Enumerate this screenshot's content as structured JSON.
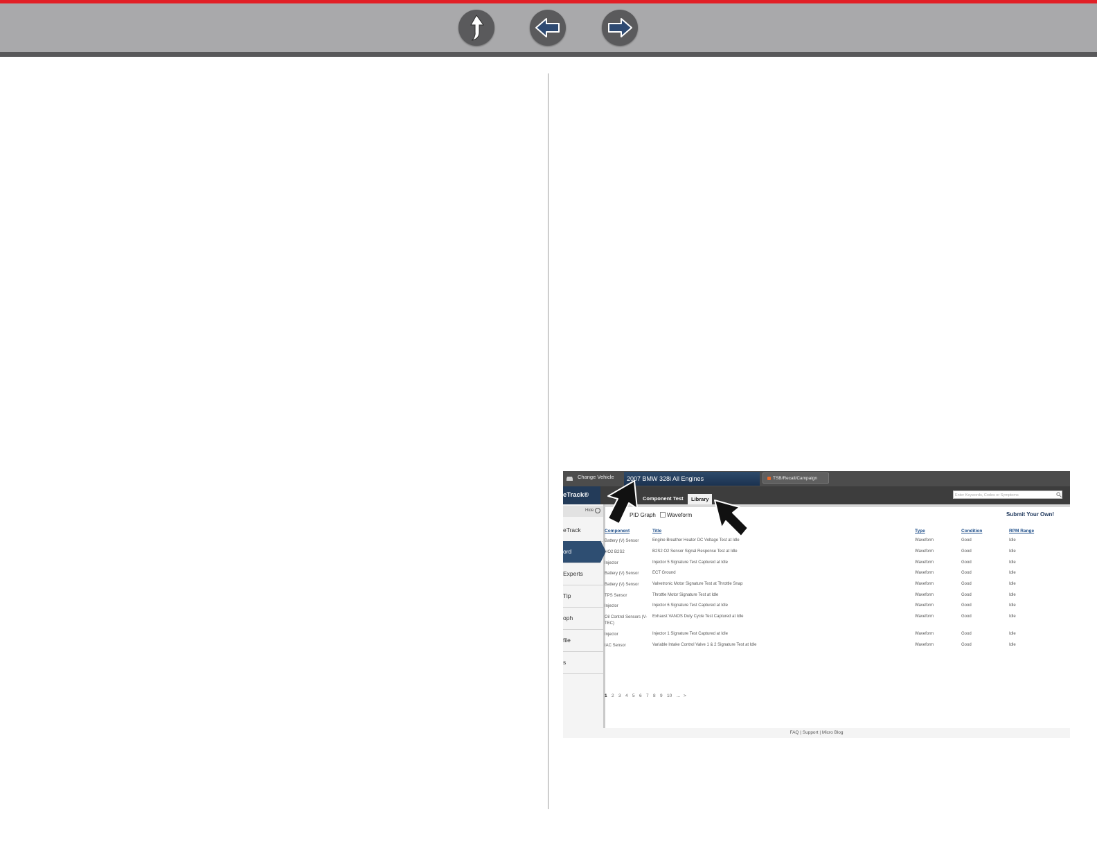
{
  "nav": {
    "up_icon": "up-arrow-icon",
    "back_icon": "left-arrow-icon",
    "forward_icon": "right-arrow-icon",
    "colors": {
      "accent": "#e21f26",
      "bar": "#a9a9ab",
      "button": "#5a5a5c"
    }
  },
  "screenshot": {
    "top_bar": {
      "change_vehicle": "Change Vehicle",
      "vehicle": "2007  BMW  328i  All Engines",
      "tsb": "TSB/Recall/Campaign"
    },
    "brand": "eTrack®",
    "tabs": [
      "Component Test",
      "Library"
    ],
    "search_placeholder": "Enter Keywords, Codes or Symptoms",
    "hide_label": "Hide",
    "sidebar_items": [
      "eTrack",
      "ord",
      "Experts",
      "Tip",
      "oph",
      "file",
      "s"
    ],
    "filters": {
      "pid_graph": "PID Graph",
      "waveform": "Waveform"
    },
    "submit_label": "Submit Your Own!",
    "table": {
      "headers": [
        "Component",
        "Title",
        "Type",
        "Condition",
        "RPM Range"
      ],
      "rows": [
        [
          "Battery (V) Sensor",
          "Engine Breather Heater DC Voltage Test at Idle",
          "Waveform",
          "Good",
          "Idle"
        ],
        [
          "HO2 B2S2",
          "B2S2 O2 Sensor Signal Response Test at Idle",
          "Waveform",
          "Good",
          "Idle"
        ],
        [
          "Injector",
          "Injector 5 Signature Test Captured at Idle",
          "Waveform",
          "Good",
          "Idle"
        ],
        [
          "Battery (V) Sensor",
          "ECT Ground",
          "Waveform",
          "Good",
          "Idle"
        ],
        [
          "Battery (V) Sensor",
          "Valvetronic Motor Signature Test at Throttle Snap",
          "Waveform",
          "Good",
          "Idle"
        ],
        [
          "TPS Sensor",
          "Throttle Motor Signature Test at Idle",
          "Waveform",
          "Good",
          "Idle"
        ],
        [
          "Injector",
          "Injector 6 Signature Test Captured at Idle",
          "Waveform",
          "Good",
          "Idle"
        ],
        [
          "Oil Control Sensors (V-TEC)",
          "Exhaust VANOS Duty Cycle Test Captured at Idle",
          "Waveform",
          "Good",
          "Idle"
        ],
        [
          "Injector",
          "Injector 1 Signature Test Captured at Idle",
          "Waveform",
          "Good",
          "Idle"
        ],
        [
          "IAC Sensor",
          "Variable Intake Control Valve 1 & 2 Signature Test at Idle",
          "Waveform",
          "Good",
          "Idle"
        ]
      ]
    },
    "pagination": [
      "1",
      "2",
      "3",
      "4",
      "5",
      "6",
      "7",
      "8",
      "9",
      "10",
      "...",
      ">"
    ],
    "footer": "FAQ | Support | Micro Blog"
  }
}
